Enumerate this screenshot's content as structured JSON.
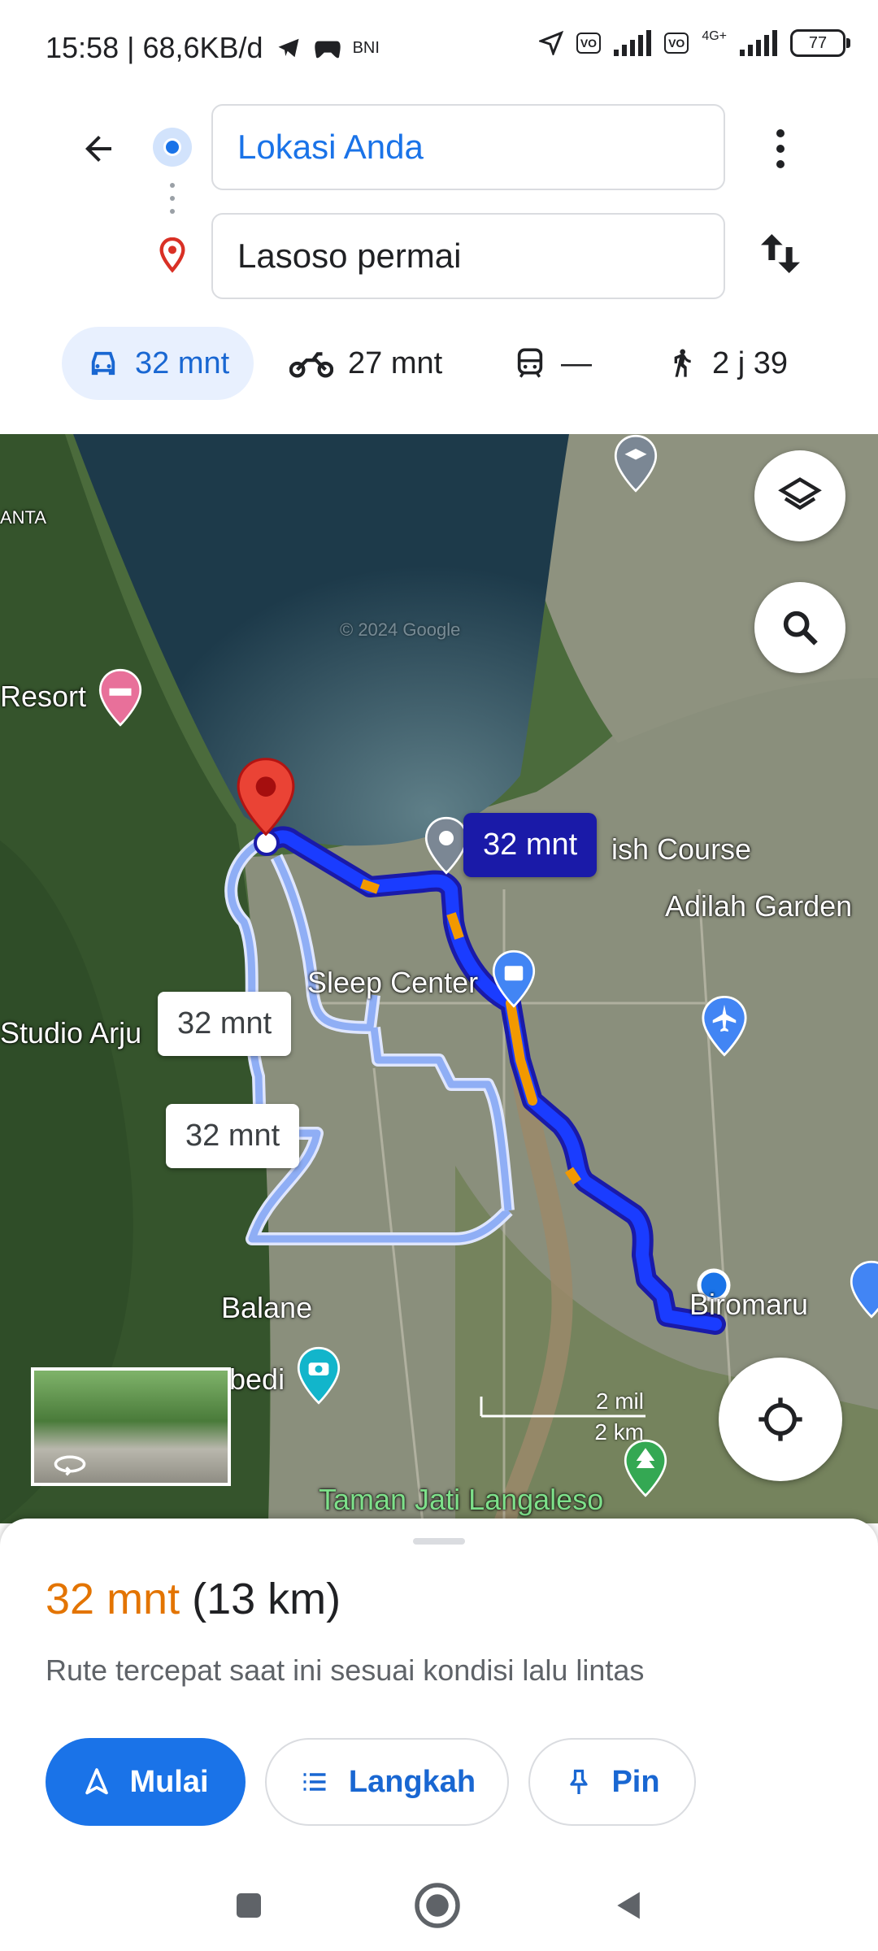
{
  "status_bar": {
    "time_speed": "15:58 | 68,6KB/d",
    "carrier_tag": "BNI",
    "network": "4G+",
    "battery": "77"
  },
  "directions": {
    "origin": "Lokasi Anda",
    "destination": "Lasoso permai"
  },
  "modes": [
    {
      "icon": "car-icon",
      "label": "32 mnt",
      "active": true
    },
    {
      "icon": "motorcycle-icon",
      "label": "27 mnt",
      "active": false
    },
    {
      "icon": "transit-icon",
      "label": "—",
      "active": false
    },
    {
      "icon": "walk-icon",
      "label": "2 j 39",
      "active": false
    }
  ],
  "map": {
    "labels": {
      "anta": "ANTA",
      "resort": "Resort",
      "course": "ish Course",
      "garden": "Adilah Garden",
      "sleep": "Sleep Center",
      "studio": "Studio Arju",
      "balane": "Balane",
      "biromaru": "Biromaru",
      "bedi": "bedi",
      "taman": "Taman Jati Langaleso",
      "watermark": "© 2024 Google"
    },
    "route_bubbles": {
      "selected": "32 mnt",
      "alt1": "32 mnt",
      "alt2": "32 mnt"
    },
    "scale": {
      "mi": "2 mil",
      "km": "2 km"
    }
  },
  "sheet": {
    "eta_time": "32 mnt",
    "eta_distance": "(13 km)",
    "description": "Rute tercepat saat ini sesuai kondisi lalu lintas",
    "start_label": "Mulai",
    "steps_label": "Langkah",
    "pin_label": "Pin"
  },
  "colors": {
    "accent": "#1a73e8",
    "eta": "#e37400",
    "route": "#1a3cff",
    "traffic": "#f29900"
  }
}
